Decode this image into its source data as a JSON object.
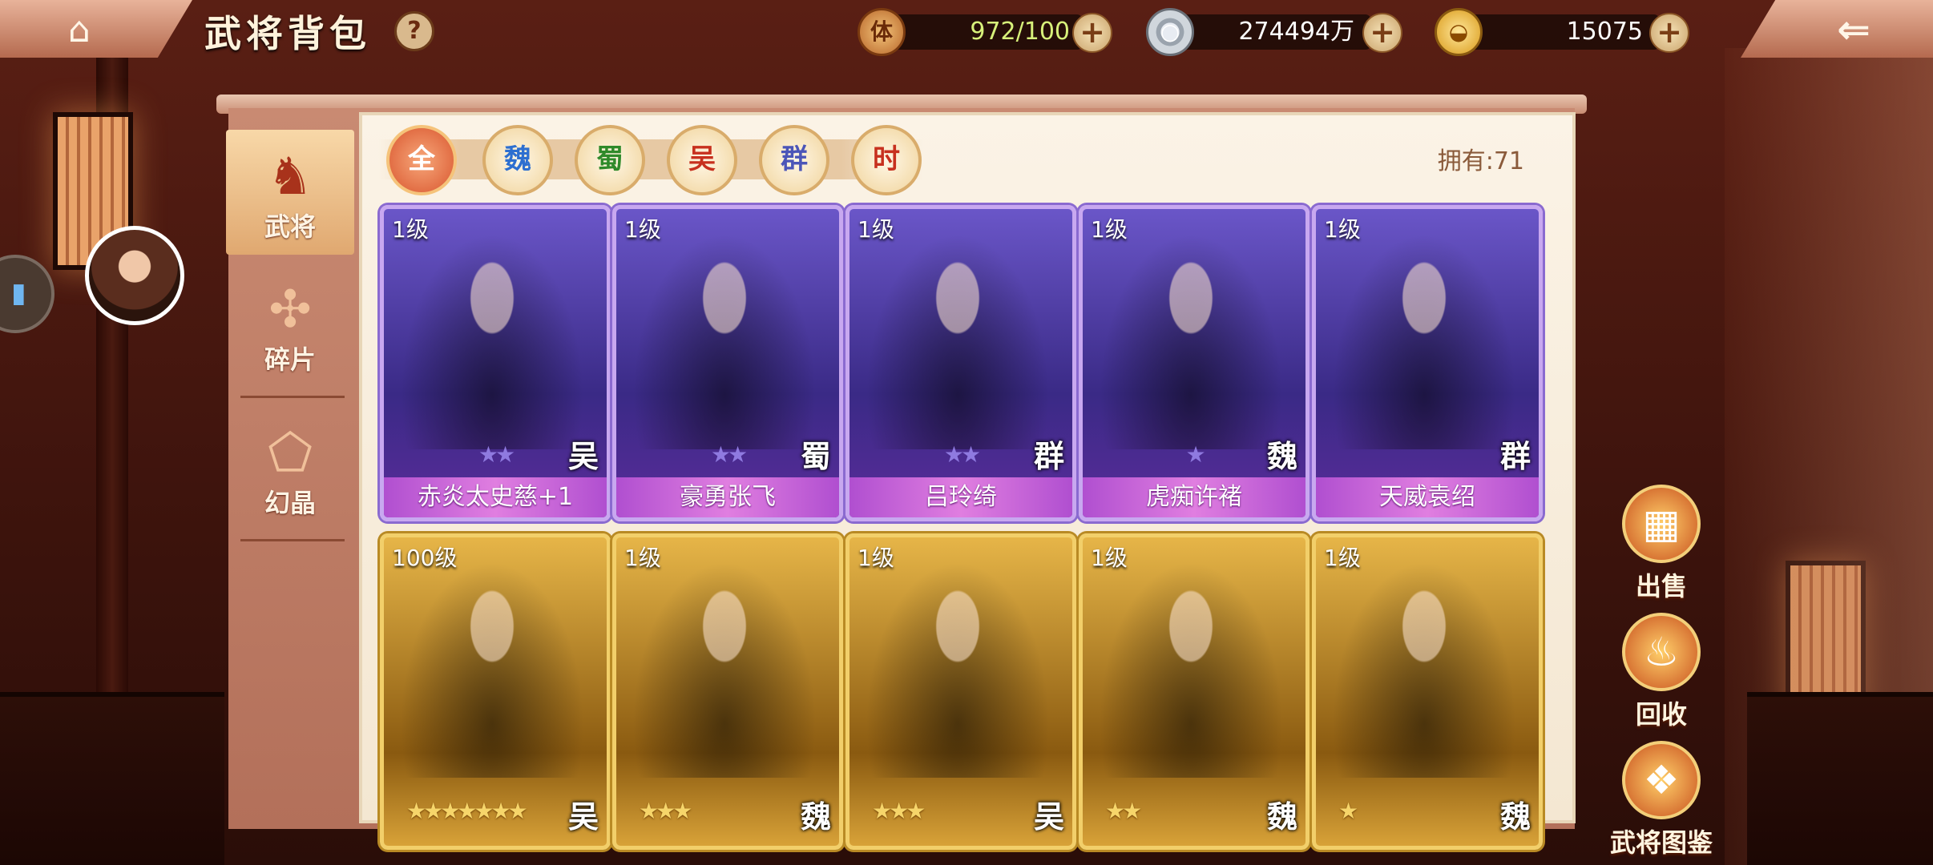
{
  "header": {
    "title": "武将背包",
    "help_label": "?",
    "stamina": {
      "icon_char": "体",
      "value": "972/100"
    },
    "coins": {
      "value": "274494万"
    },
    "gold": {
      "value": "15075"
    }
  },
  "tabs": [
    {
      "label": "武将",
      "icon": "general-icon",
      "active": true
    },
    {
      "label": "碎片",
      "icon": "puzzle-icon",
      "active": false
    },
    {
      "label": "幻晶",
      "icon": "crystal-icon",
      "active": false
    }
  ],
  "filters": [
    "全",
    "魏",
    "蜀",
    "吴",
    "群",
    "时"
  ],
  "filter_colors": [
    "#ffffff",
    "#2d6fd0",
    "#2f8a2a",
    "#c7301e",
    "#4b55b8",
    "#c7301e"
  ],
  "owned": "拥有:71",
  "cards": [
    {
      "level": "1级",
      "stars": 2,
      "faction": "吴",
      "name": "赤炎太史慈+1",
      "frame": "purple"
    },
    {
      "level": "1级",
      "stars": 2,
      "faction": "蜀",
      "name": "豪勇张飞",
      "frame": "purple"
    },
    {
      "level": "1级",
      "stars": 2,
      "faction": "群",
      "name": "吕玲绮",
      "frame": "purple"
    },
    {
      "level": "1级",
      "stars": 1,
      "faction": "魏",
      "name": "虎痴许褚",
      "frame": "purple"
    },
    {
      "level": "1级",
      "stars": 0,
      "faction": "群",
      "name": "天威袁绍",
      "frame": "purple"
    },
    {
      "level": "100级",
      "stars": 7,
      "faction": "吴",
      "name": "",
      "frame": "gold"
    },
    {
      "level": "1级",
      "stars": 3,
      "faction": "魏",
      "name": "",
      "frame": "gold"
    },
    {
      "level": "1级",
      "stars": 3,
      "faction": "吴",
      "name": "",
      "frame": "gold"
    },
    {
      "level": "1级",
      "stars": 2,
      "faction": "魏",
      "name": "",
      "frame": "gold"
    },
    {
      "level": "1级",
      "stars": 1,
      "faction": "魏",
      "name": "",
      "frame": "gold"
    }
  ],
  "actions": [
    {
      "label": "出售",
      "icon": "abacus-icon"
    },
    {
      "label": "回收",
      "icon": "cauldron-icon"
    },
    {
      "label": "武将图鉴",
      "icon": "codex-icon"
    }
  ]
}
